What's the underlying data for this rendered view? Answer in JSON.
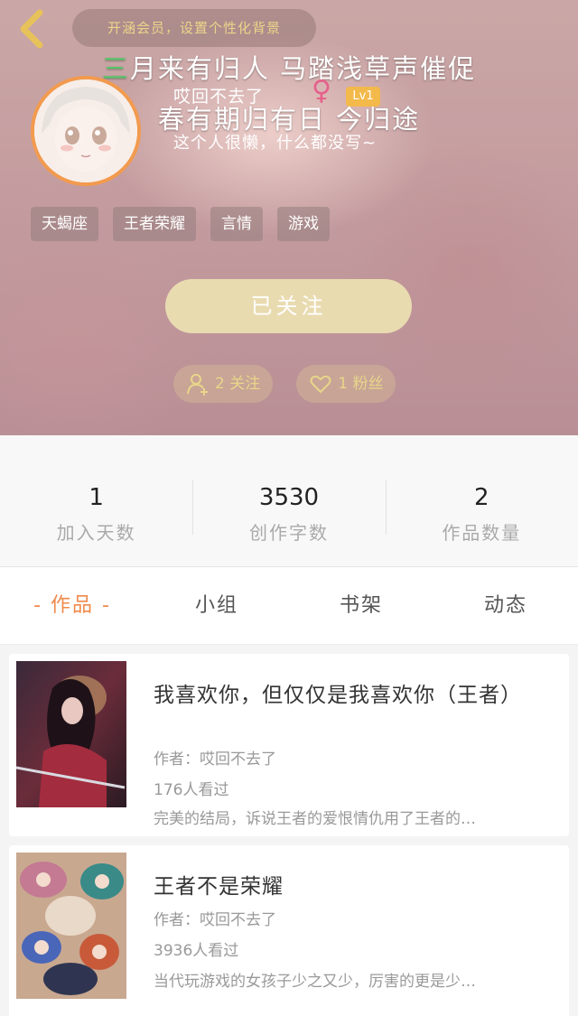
{
  "header": {
    "vip_banner": "开涵会员，设置个性化背景",
    "signature_line1_highlight": "三",
    "signature_line1_rest": "月来有归人 马踏浅草声催促",
    "signature_line2": "春有期归有日 今归途",
    "nickname": "哎回不去了",
    "gender_symbol": "♀",
    "level": "Lv1",
    "bio": "这个人很懒，什么都没写~",
    "tags": [
      "天蝎座",
      "王者荣耀",
      "言情",
      "游戏"
    ],
    "follow_button": "已关注",
    "following_chip": "2 关注",
    "fans_chip": "1 粉丝"
  },
  "colors": {
    "accent": "#f08a4b",
    "avatar_ring": "#f29a4e",
    "vip_text": "#e9d58a",
    "follow_button_bg": "#e9dbb0",
    "gender": "#e6608a",
    "level_badge": "#f3b94a",
    "highlight_char": "#56c46a"
  },
  "stats": [
    {
      "value": "1",
      "label": "加入天数"
    },
    {
      "value": "3530",
      "label": "创作字数"
    },
    {
      "value": "2",
      "label": "作品数量"
    }
  ],
  "tabs": [
    {
      "label": "- 作品 -",
      "active": true
    },
    {
      "label": "小组",
      "active": false
    },
    {
      "label": "书架",
      "active": false
    },
    {
      "label": "动态",
      "active": false
    }
  ],
  "works": [
    {
      "title": "我喜欢你，但仅仅是我喜欢你（王者）",
      "author": "作者：哎回不去了",
      "views": "176人看过",
      "desc": "完美的结局，诉说王者的爱恨情仇用了王者的…"
    },
    {
      "title": "王者不是荣耀",
      "author": "作者：哎回不去了",
      "views": "3936人看过",
      "desc": "当代玩游戏的女孩子少之又少，厉害的更是少…"
    }
  ]
}
